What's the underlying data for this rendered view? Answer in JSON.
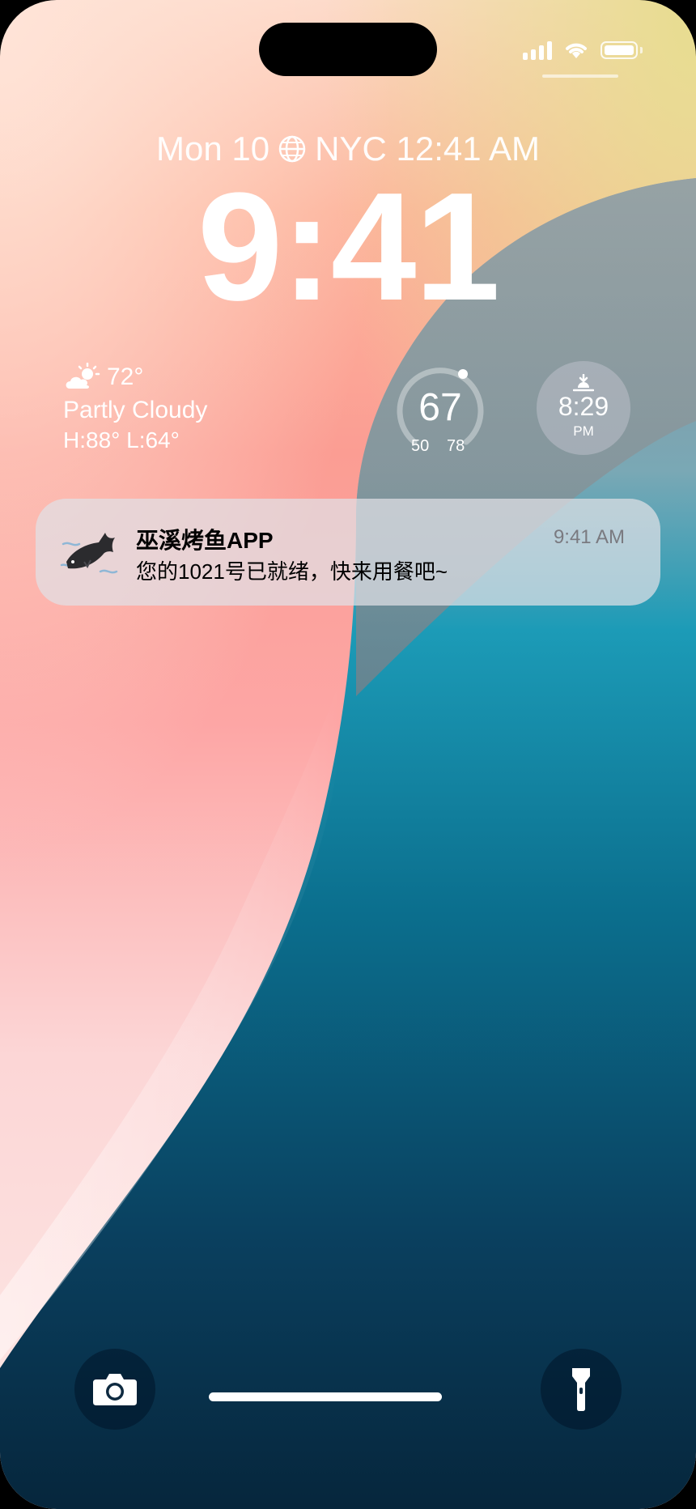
{
  "status_bar": {
    "signal_icon": "cellular-signal-icon",
    "wifi_icon": "wifi-icon",
    "battery_icon": "battery-icon"
  },
  "lock_screen": {
    "date_line": {
      "day": "Mon 10",
      "city_time": "NYC 12:41 AM",
      "icon": "globe-icon"
    },
    "time": "9:41",
    "weather": {
      "icon": "partly-cloudy-icon",
      "temp": "72°",
      "condition": "Partly Cloudy",
      "high_low": "H:88° L:64°"
    },
    "gauge": {
      "value": "67",
      "low": "50",
      "high": "78"
    },
    "sunset": {
      "time": "8:29",
      "ampm": "PM",
      "icon": "sunset-icon"
    }
  },
  "notification": {
    "app_name": "巫溪烤鱼APP",
    "message": "您的1021号已就绪，快来用餐吧~",
    "time": "9:41 AM",
    "icon": "fish-app-icon"
  },
  "bottom_bar": {
    "camera_icon": "camera-icon",
    "flashlight_icon": "flashlight-icon"
  },
  "colors": {
    "teal_deep": "#0a3f5e",
    "teal_mid": "#0e8aa5",
    "coral": "#fb9d93"
  }
}
